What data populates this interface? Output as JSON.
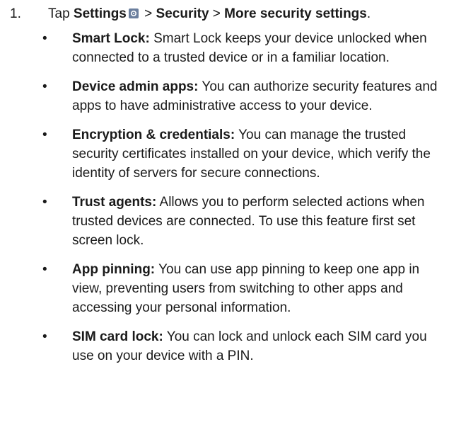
{
  "step": {
    "number": "1.",
    "prefix": "Tap ",
    "settings": "Settings",
    "sep1": " > ",
    "security": "Security",
    "sep2": " > ",
    "more": "More security settings",
    "suffix": "."
  },
  "icon": "settings-gear-icon",
  "items": [
    {
      "title": "Smart Lock:",
      "text": " Smart Lock keeps your device unlocked when connected to a trusted device or in a familiar location."
    },
    {
      "title": "Device admin apps:",
      "text": " You can authorize security features and apps to have administrative access to your device."
    },
    {
      "title": "Encryption & credentials:",
      "text": " You can manage the trusted security certificates installed on your device, which verify the identity of servers for secure connections."
    },
    {
      "title": "Trust agents:",
      "text": " Allows you to perform selected actions when trusted devices are connected. To use this feature first set screen lock."
    },
    {
      "title": "App pinning:",
      "text": " You can use app pinning to keep one app in view, preventing users from switching to other apps and accessing your personal information."
    },
    {
      "title": "SIM card lock:",
      "text": " You can lock and unlock each SIM card you use on your device with a PIN."
    }
  ]
}
